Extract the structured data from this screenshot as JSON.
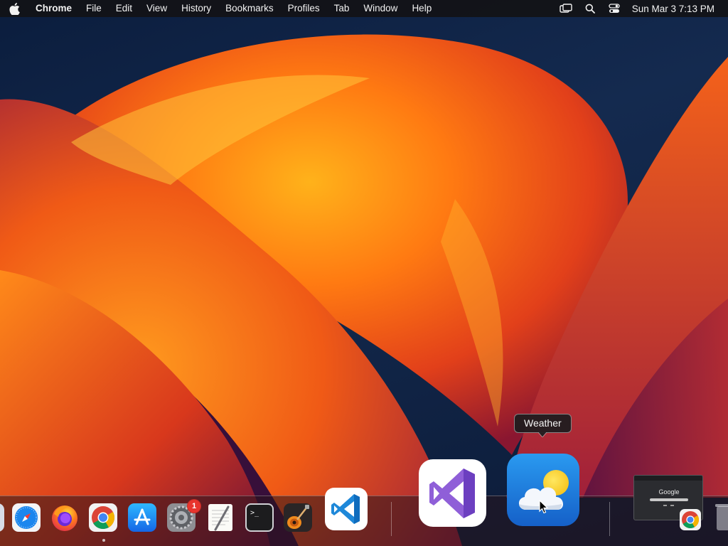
{
  "menubar": {
    "apple_icon": "apple-logo-icon",
    "app_name": "Chrome",
    "items": [
      "File",
      "Edit",
      "View",
      "History",
      "Bookmarks",
      "Profiles",
      "Tab",
      "Window",
      "Help"
    ],
    "status_icons": [
      "screen-mirroring-icon",
      "spotlight-search-icon",
      "control-center-icon"
    ],
    "clock": "Sun Mar 3  7:13 PM"
  },
  "dock": {
    "apps": [
      {
        "id": "finder-partial",
        "icon": "finder-icon"
      },
      {
        "id": "safari",
        "icon": "safari-icon"
      },
      {
        "id": "firefox",
        "icon": "firefox-icon"
      },
      {
        "id": "chrome",
        "icon": "chrome-icon",
        "running": true
      },
      {
        "id": "app-store",
        "icon": "app-store-icon"
      },
      {
        "id": "system-settings",
        "icon": "gear-icon",
        "badge": "1"
      },
      {
        "id": "textedit",
        "icon": "textedit-icon"
      },
      {
        "id": "terminal",
        "icon": "terminal-icon",
        "glyph": ">_"
      },
      {
        "id": "garageband",
        "icon": "guitar-icon"
      },
      {
        "id": "vscode",
        "icon": "vscode-icon"
      },
      {
        "id": "visual-studio",
        "icon": "visual-studio-icon"
      },
      {
        "id": "weather",
        "icon": "weather-cloud-sun-icon",
        "hovered": true
      }
    ],
    "tooltip": "Weather",
    "minimized_window": {
      "label": "Google",
      "app_icon": "chrome-icon"
    }
  },
  "colors": {
    "menubar_bg": "#121216",
    "badge_red": "#e8352e",
    "weather_blue": "#1f7fe0",
    "vs_purple": "#8f5fd8",
    "vscode_blue": "#1e88d9"
  }
}
